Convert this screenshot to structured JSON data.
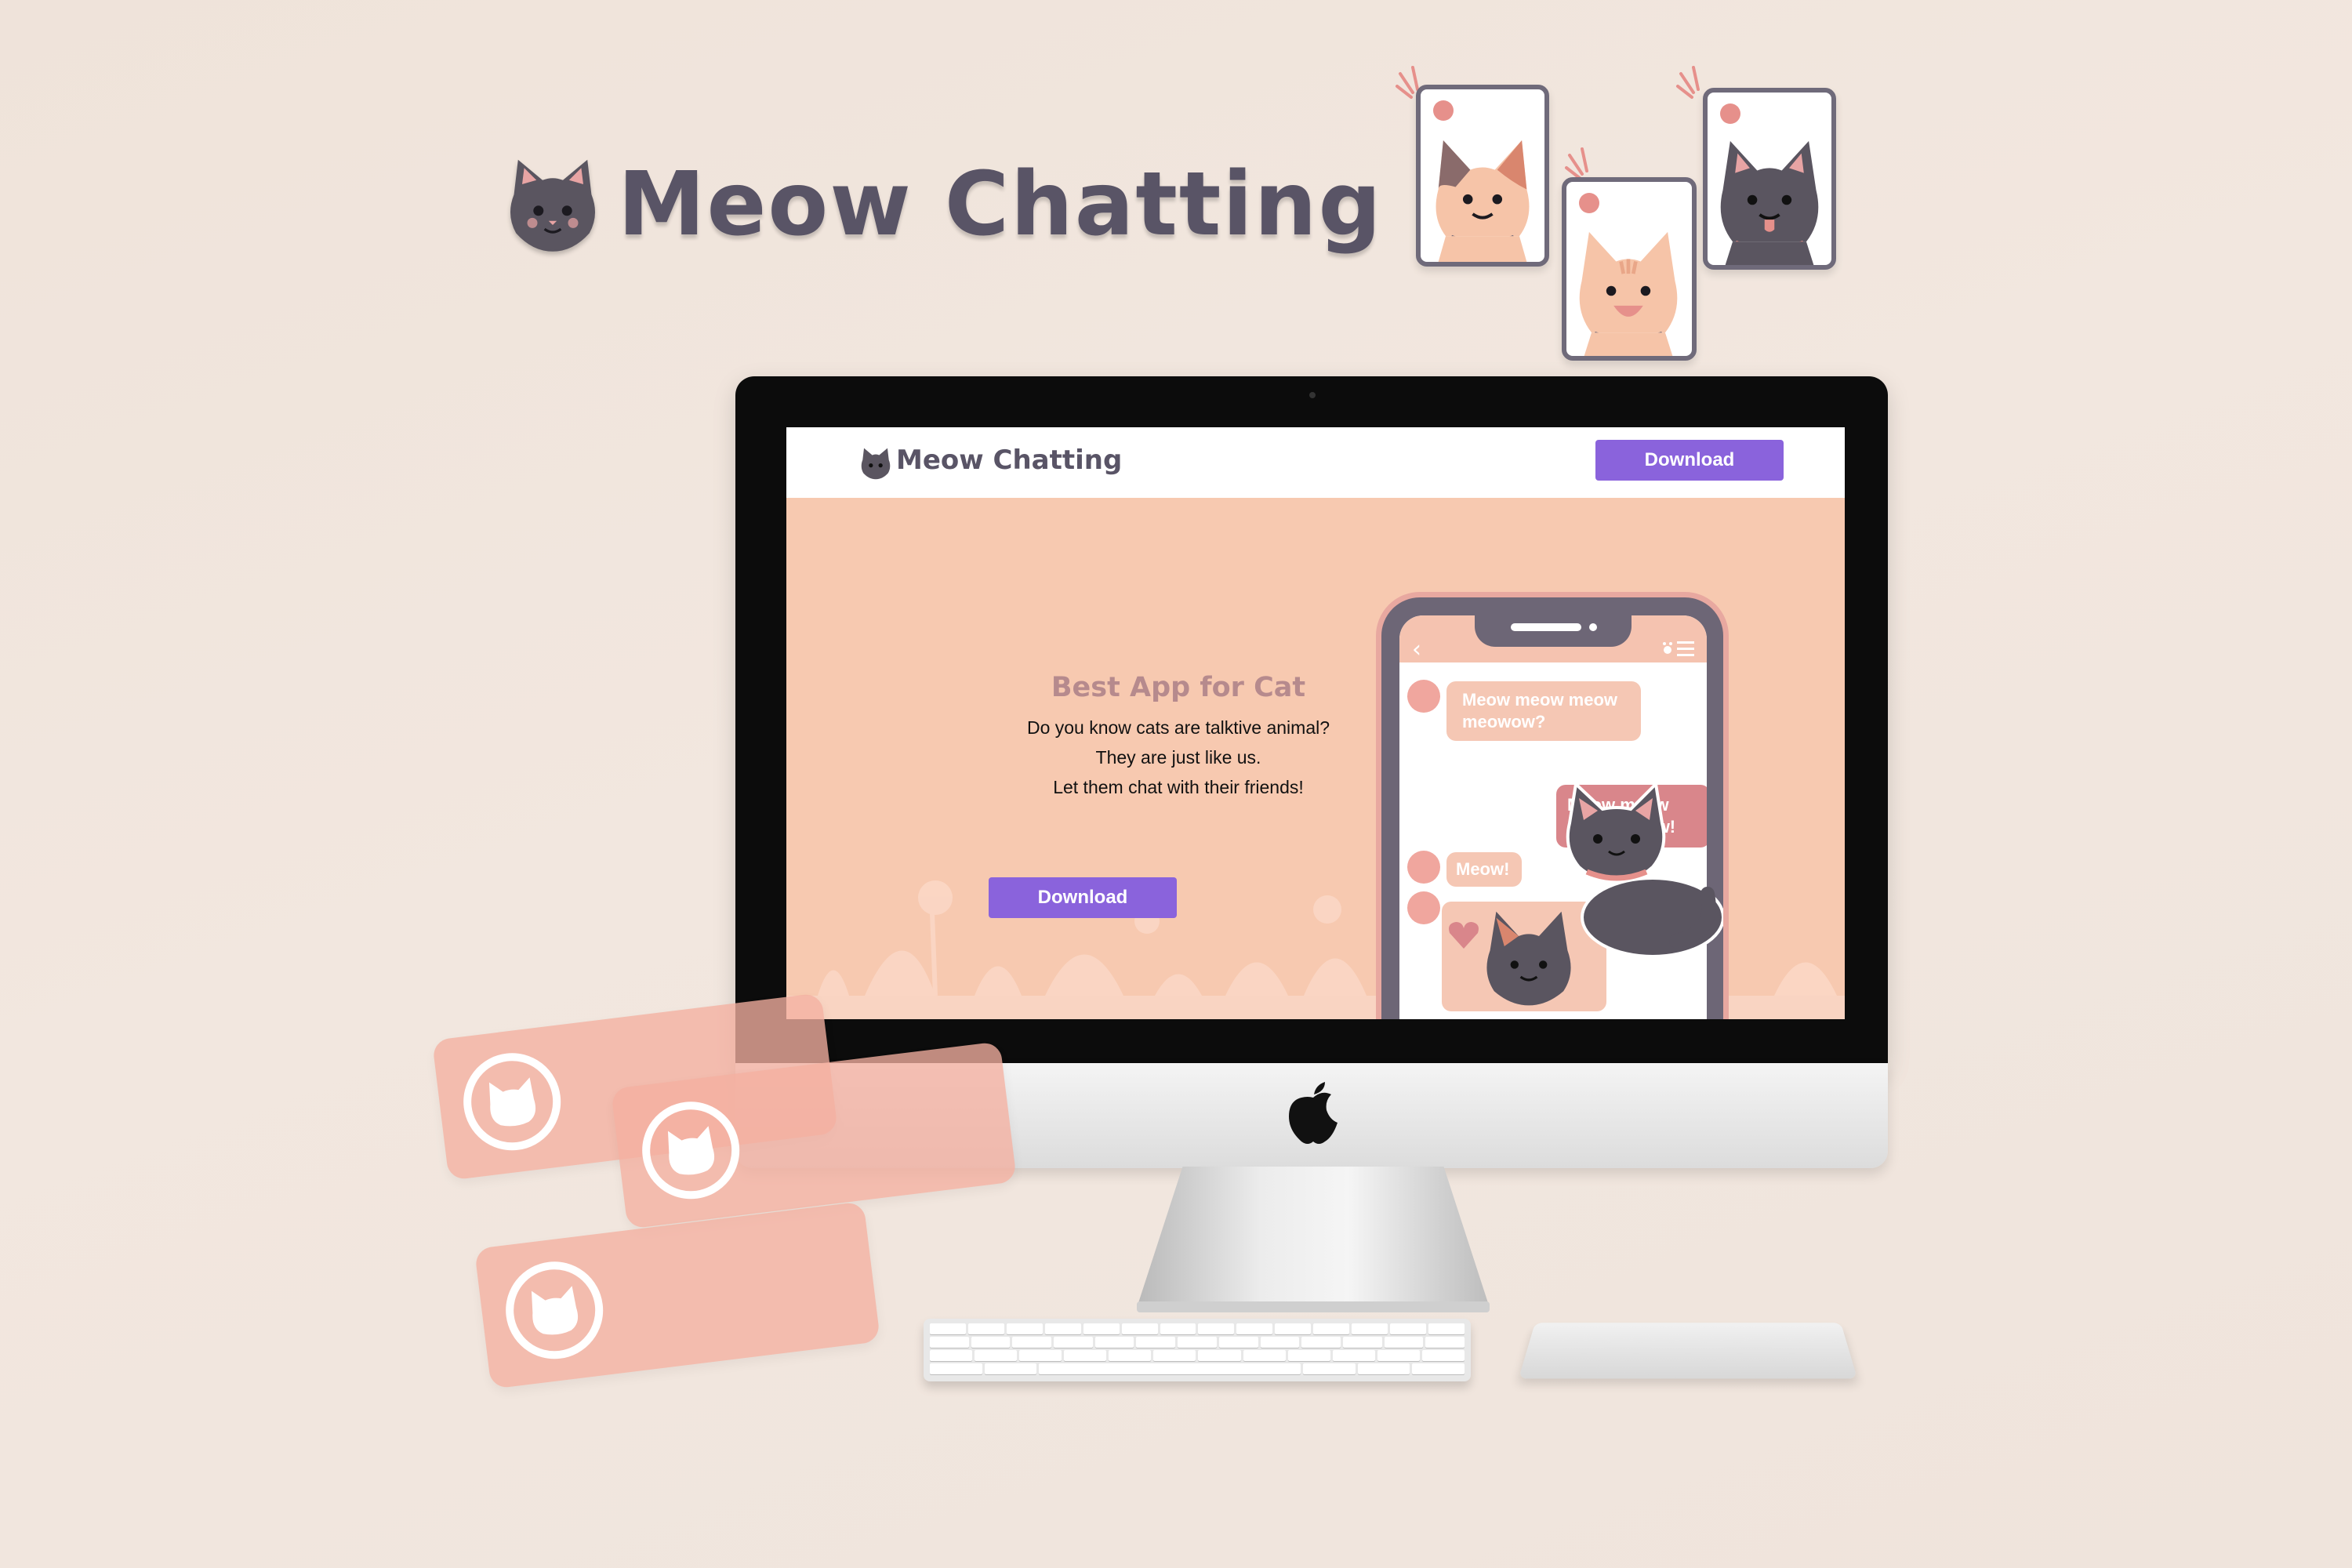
{
  "brand": {
    "name": "Meow Chatting"
  },
  "website": {
    "nav": {
      "title": "Meow Chatting",
      "download_label": "Download"
    },
    "hero": {
      "title": "Best App for Cat",
      "lines": [
        "Do you know cats are talktive animal?",
        "They are just like us.",
        "Let them chat with their friends!"
      ],
      "download_label": "Download"
    },
    "phone_chat": {
      "back_icon": "chevron-left-icon",
      "menu_icon": "paw-menu-icon",
      "messages": [
        {
          "side": "in",
          "text": "Meow meow meow meowow?"
        },
        {
          "side": "out",
          "text": "Meow meow meow meow!"
        },
        {
          "side": "in",
          "text": "Meow!"
        }
      ],
      "sticker": "cat-sticker"
    }
  },
  "colors": {
    "accent_purple": "#8a63dc",
    "hero_bg": "#f7c9b0",
    "brand_text": "#595466",
    "bubble_in": "#f5c7b4",
    "bubble_out": "#d9868b"
  },
  "decor": {
    "cat_cards": [
      "calico-cat-icon",
      "orange-cat-icon",
      "gray-cat-icon"
    ],
    "notifications": [
      "cat-avatar-icon",
      "cat-avatar-icon",
      "cat-avatar-icon"
    ]
  }
}
